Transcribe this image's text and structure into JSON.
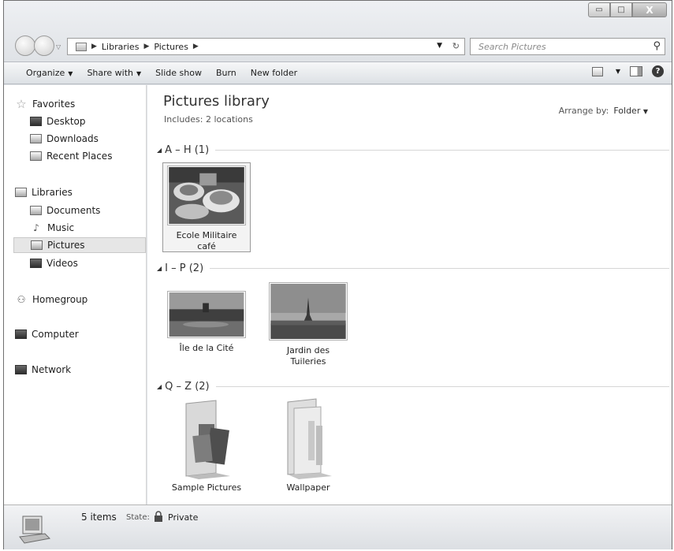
{
  "window": {
    "minimize_glyph": "▭",
    "maximize_glyph": "□",
    "close_glyph": "X"
  },
  "address": {
    "crumbs": [
      "Libraries",
      "Pictures"
    ]
  },
  "search": {
    "placeholder": "Search Pictures"
  },
  "toolbar": {
    "organize": "Organize",
    "share_with": "Share with",
    "slide_show": "Slide show",
    "burn": "Burn",
    "new_folder": "New folder"
  },
  "sidebar": {
    "favorites": "Favorites",
    "desktop": "Desktop",
    "downloads": "Downloads",
    "recent_places": "Recent Places",
    "libraries": "Libraries",
    "documents": "Documents",
    "music": "Music",
    "pictures": "Pictures",
    "videos": "Videos",
    "homegroup": "Homegroup",
    "computer": "Computer",
    "network": "Network"
  },
  "library": {
    "title": "Pictures library",
    "includes": "Includes:  2 locations",
    "arrange_label": "Arrange by:",
    "arrange_value": "Folder"
  },
  "groups": [
    {
      "label": "A – H (1)",
      "items": [
        {
          "line1": "Ecole Militaire",
          "line2": "café",
          "icon": "photo-cafe-thumbnail"
        }
      ]
    },
    {
      "label": "I – P (2)",
      "items": [
        {
          "line1": "Île de la Cité",
          "line2": "",
          "icon": "photo-river-thumbnail"
        },
        {
          "line1": "Jardin des",
          "line2": "Tuileries",
          "icon": "photo-eiffel-thumbnail"
        }
      ]
    },
    {
      "label": "Q – Z (2)",
      "items": [
        {
          "line1": "Sample Pictures",
          "line2": "",
          "icon": "folder-with-photos-icon"
        },
        {
          "line1": "Wallpaper",
          "line2": "",
          "icon": "folder-icon"
        }
      ]
    }
  ],
  "status": {
    "count": "5 items",
    "state_label": "State:",
    "state_value": "Private"
  }
}
